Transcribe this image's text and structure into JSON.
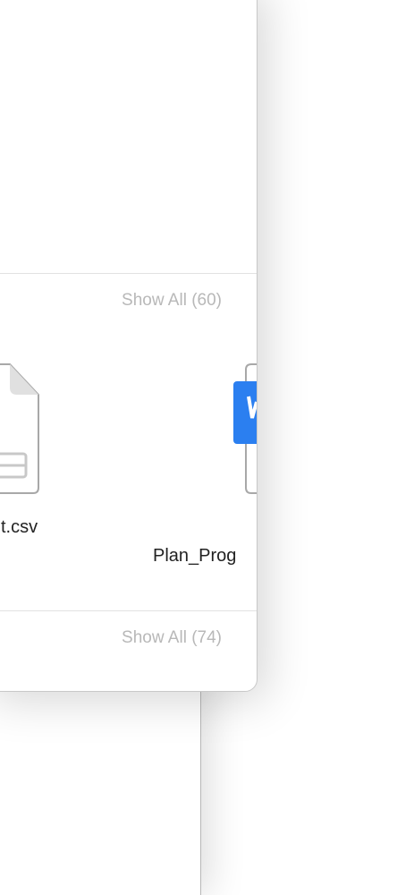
{
  "sections": [
    {
      "show_all_label": "Show All (60)"
    },
    {
      "show_all_label": "Show All (74)"
    }
  ],
  "files": [
    {
      "name": "t.csv",
      "icon": "csv-file-icon"
    },
    {
      "name": "Plan_Prog",
      "icon": "word-document-icon",
      "accent": "#2b7ff0"
    }
  ]
}
